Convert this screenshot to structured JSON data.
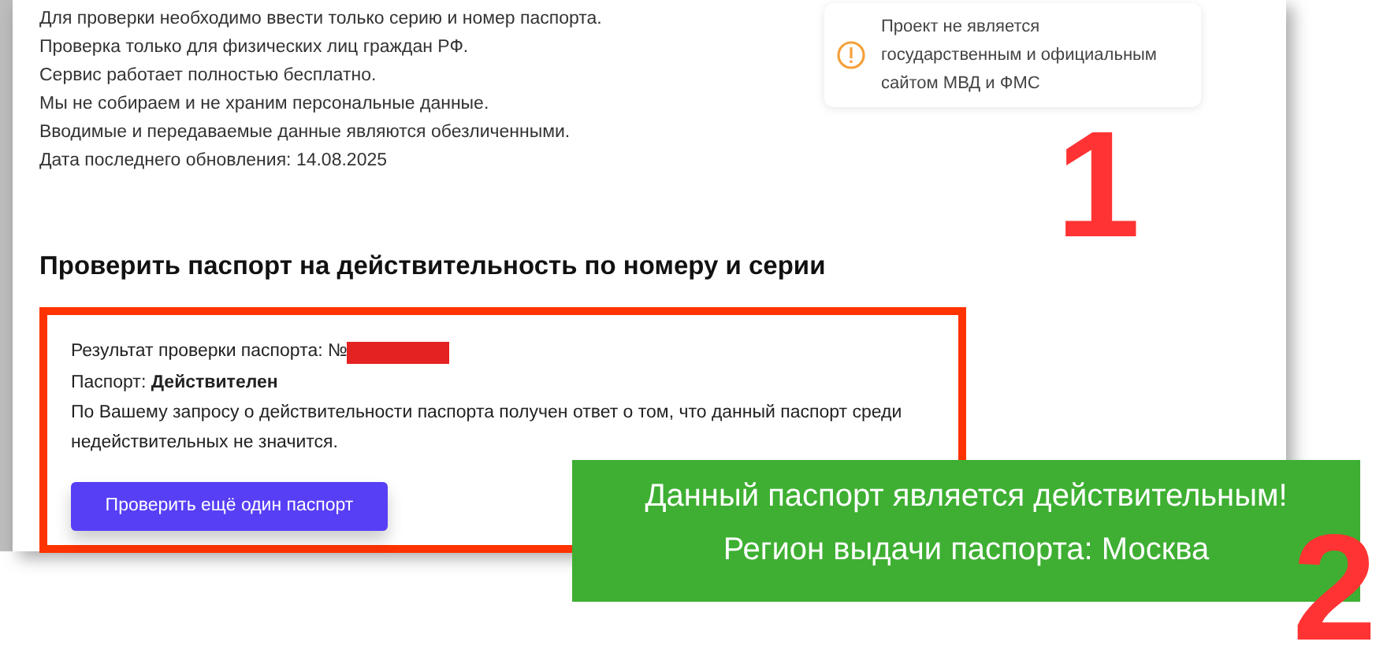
{
  "info_lines": [
    "Для проверки необходимо ввести только серию и номер паспорта.",
    "Проверка только для физических лиц граждан РФ.",
    "Сервис работает полностью бесплатно.",
    "Мы не собираем и не храним персональные данные.",
    "Вводимые и передаваемые данные являются обезличенными.",
    "Дата последнего обновления: 14.08.2025"
  ],
  "notice": {
    "text": "Проект не является государственным и официальным сайтом МВД и ФМС"
  },
  "section_title": "Проверить паспорт на действительность по номеру и серии",
  "result": {
    "number_label": "Результат проверки паспорта: №",
    "number_redacted": true,
    "status": "Паспорт: **Действителен**",
    "message": "По Вашему запросу о действительности паспорта получен ответ о том, что данный паспорт среди недействительных не значится.",
    "button": "Проверить ещё один паспорт"
  },
  "banner": {
    "lines": [
      "Данный паспорт является действительным!",
      "Регион выдачи паспорта: Москва"
    ]
  },
  "annotations": [
    "1",
    "2"
  ]
}
